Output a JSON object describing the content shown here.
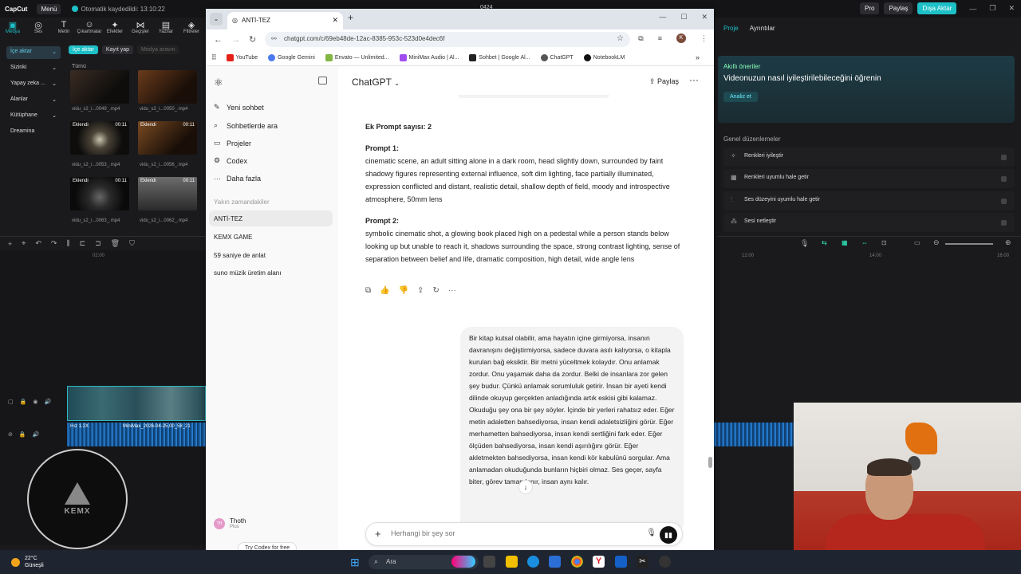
{
  "capcut": {
    "logo": "CapCut",
    "menu": "Menü",
    "autosave": "Otomatik kaydedildi: 13:10:22",
    "center_title": "0424",
    "right_buttons": [
      "Pro",
      "Paylaş",
      "Dışa Aktar"
    ],
    "tools": [
      "Medya",
      "Ses",
      "Metin",
      "Çıkartmalar",
      "Efektler",
      "Geçişler",
      "Yazılar",
      "Filtreler"
    ],
    "side_items": [
      "İçe aktar",
      "Sizinki",
      "Yapay zeka ...",
      "Alanlar",
      "Kütüphane",
      "Dreamina"
    ],
    "subtabs": [
      "İçe aktar",
      "Kayıt yap",
      "Medya aravın"
    ],
    "all_label": "Tümü",
    "clips": [
      {
        "name": "vidu_s2_i...0049_.mp4",
        "badge": "",
        "dur": ""
      },
      {
        "name": "vidu_s2_i...0050_.mp4",
        "badge": "",
        "dur": ""
      },
      {
        "name": "vidu_s2_i...0053_.mp4",
        "badge": "Eklendi",
        "dur": "00:11"
      },
      {
        "name": "vidu_s2_i...0056_.mp4",
        "badge": "Eklendi",
        "dur": "00:11"
      },
      {
        "name": "vidu_s2_i...0063_.mp4",
        "badge": "Eklendi",
        "dur": "00:11"
      },
      {
        "name": "vidu_s2_i...0062_.mp4",
        "badge": "Eklendi",
        "dur": "00:11"
      }
    ],
    "ruler_left": "02:00",
    "ruler_right": [
      "12:00",
      "14:00",
      "16:00"
    ],
    "audio_label": "Hız 1.2X",
    "audio_name": "MiniMax_2026-04-25,00_58_21",
    "logo_text": "KEMX",
    "right_tabs": [
      "Proje",
      "Ayrıntılar"
    ],
    "ai_title": "Akıllı öneriler",
    "ai_head": "Videonuzun nasıl iyileştirilebileceğini öğrenin",
    "ai_button": "Analiz et",
    "adj_title": "Genel düzenlemeler",
    "adjustments": [
      "Renkleri iyileştir",
      "Renkleri uyumlu hale getir",
      "Ses düzeyini uyumlu hale getir",
      "Sesi netleştir"
    ]
  },
  "chrome": {
    "tab_title": "ANTİ-TEZ",
    "url": "chatgpt.com/c/69eb48de-12ac-8385-953c-523d0e4dec6f",
    "profile": "K",
    "bookmarks": [
      {
        "label": "YouTube",
        "color": "#e62117"
      },
      {
        "label": "Google Gemini",
        "color": "#4a7af0"
      },
      {
        "label": "Envato — Unlimited...",
        "color": "#82b541"
      },
      {
        "label": "MiniMax Audio | Al...",
        "color": "#a14cf0"
      },
      {
        "label": "Sohbet | Google Al...",
        "color": "#222222"
      },
      {
        "label": "ChatGPT",
        "color": "#555555"
      },
      {
        "label": "NotebookLM",
        "color": "#111111"
      }
    ]
  },
  "chatgpt": {
    "title": "ChatGPT",
    "share": "Paylaş",
    "nav": [
      {
        "label": "Yeni sohbet",
        "icon": "✎"
      },
      {
        "label": "Sohbetlerde ara",
        "icon": "⌕"
      },
      {
        "label": "Projeler",
        "icon": "▭"
      },
      {
        "label": "Codex",
        "icon": "⚙"
      },
      {
        "label": "Daha fazla",
        "icon": "···"
      }
    ],
    "recent_header": "Yakın zamandakiler",
    "chats": [
      "ANTİ-TEZ",
      "KEMX GAME",
      "59 saniye de anlat",
      "suno müzik üretim alanı"
    ],
    "user_initials": "TH",
    "user_name": "Thoth",
    "user_plan": "Plus",
    "codex_promo": "Try Codex for free",
    "extra_heading": "Ek Prompt sayısı: 2",
    "prompt1_title": "Prompt 1:",
    "prompt1": "cinematic scene, an adult sitting alone in a dark room, head slightly down, surrounded by faint shadowy figures representing external influence, soft dim lighting, face partially illuminated, expression conflicted and distant, realistic detail, shallow depth of field, moody and introspective atmosphere, 50mm lens",
    "prompt2_title": "Prompt 2:",
    "prompt2": "symbolic cinematic shot, a glowing book placed high on a pedestal while a person stands below looking up but unable to reach it, shadows surrounding the space, strong contrast lighting, sense of separation between belief and life, dramatic composition, high detail, wide angle lens",
    "user_message": "Bir kitap kutsal olabilir, ama hayatın içine girmiyorsa, insanın davranışını değiştirmiyorsa, sadece duvara asılı kalıyorsa, o kitapla kurulan bağ eksiktir. Bir metni yüceltmek kolaydır. Onu anlamak zordur. Onu yaşamak daha da zordur. Belki de insanlara zor gelen şey budur. Çünkü anlamak sorumluluk getirir. İnsan bir ayeti kendi dilinde okuyup gerçekten anladığında artık eskisi gibi kalamaz. Okuduğu şey ona bir şey söyler. İçinde bir yerleri rahatsız eder. Eğer metin adaletten bahsediyorsa, insan kendi adaletsizliğini görür. Eğer merhametten bahsediyorsa, insan kendi sertliğini fark eder. Eğer ölçüden bahsediyorsa, insan kendi aşırılığını görür. Eğer akletmekten bahsediyorsa, insan kendi kör kabulünü sorgular. Ama anlamadan okuduğunda bunların hiçbiri olmaz. Ses geçer, sayfa biter, görev tamamlanır, insan aynı kalır.",
    "composer_placeholder": "Herhangi bir şey sor"
  },
  "taskbar": {
    "temp": "22°C",
    "weather": "Güneşli",
    "search": "Ara"
  }
}
